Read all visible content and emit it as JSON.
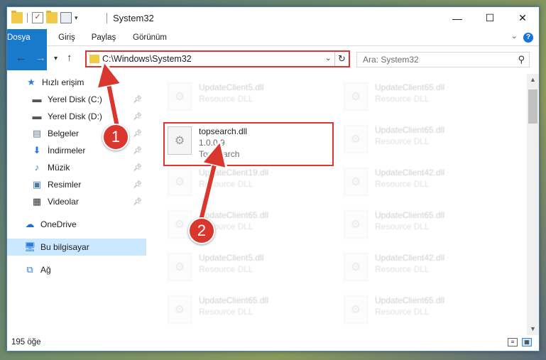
{
  "window": {
    "title": "System32",
    "controls": {
      "minimize": "—",
      "maximize": "☐",
      "close": "✕"
    }
  },
  "ribbon": {
    "tabs": [
      "Dosya",
      "Giriş",
      "Paylaş",
      "Görünüm"
    ],
    "help": "?"
  },
  "address": {
    "path": "C:\\Windows\\System32",
    "search_placeholder": "Ara: System32"
  },
  "sidebar": {
    "items": [
      {
        "label": "Hızlı erişim",
        "icon": "star-icon",
        "pinned": false
      },
      {
        "label": "Yerel Disk (C:)",
        "icon": "drive-icon",
        "pinned": true
      },
      {
        "label": "Yerel Disk (D:)",
        "icon": "drive-icon",
        "pinned": true
      },
      {
        "label": "Belgeler",
        "icon": "documents-icon",
        "pinned": true
      },
      {
        "label": "İndirmeler",
        "icon": "download-icon",
        "pinned": true
      },
      {
        "label": "Müzik",
        "icon": "music-icon",
        "pinned": true
      },
      {
        "label": "Resimler",
        "icon": "pictures-icon",
        "pinned": true
      },
      {
        "label": "Videolar",
        "icon": "video-icon",
        "pinned": true
      },
      {
        "label": "OneDrive",
        "icon": "cloud-icon",
        "pinned": false
      },
      {
        "label": "Bu bilgisayar",
        "icon": "computer-icon",
        "pinned": false,
        "selected": true
      },
      {
        "label": "Ağ",
        "icon": "network-icon",
        "pinned": false
      }
    ]
  },
  "files": {
    "left": [
      {
        "name": "UpdateClient5.dll",
        "meta": "Resource DLL"
      },
      {
        "name": "topsearch.dll",
        "version": "1.0.0.9",
        "meta": "TopSearch",
        "highlight": true
      },
      {
        "name": "UpdateClient19.dll",
        "meta": "Resource DLL"
      },
      {
        "name": "UpdateClient65.dll",
        "meta": "Resource DLL"
      },
      {
        "name": "UpdateClient5.dll",
        "meta": "Resource DLL"
      },
      {
        "name": "UpdateClient65.dll",
        "meta": "Resource DLL"
      }
    ],
    "right": [
      {
        "name": "UpdateClient65.dll",
        "meta": "Resource DLL"
      },
      {
        "name": "UpdateClient65.dll",
        "meta": "Resource DLL"
      },
      {
        "name": "UpdateClient42.dll",
        "meta": "Resource DLL"
      },
      {
        "name": "UpdateClient65.dll",
        "meta": "Resource DLL"
      },
      {
        "name": "UpdateClient42.dll",
        "meta": "Resource DLL"
      },
      {
        "name": "UpdateClient65.dll",
        "meta": "Resource DLL"
      }
    ]
  },
  "status": {
    "count": "195 öğe"
  },
  "callouts": {
    "one": "1",
    "two": "2"
  },
  "colors": {
    "accent": "#1979ca",
    "highlight": "#e0342e",
    "selected": "#cce8ff"
  }
}
